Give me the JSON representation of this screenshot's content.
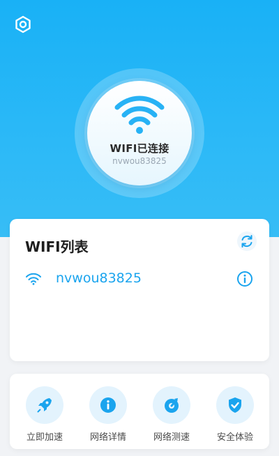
{
  "theme": {
    "accent": "#1aa4ee",
    "hero_gradient_top": "#19b1f6",
    "hero_gradient_bottom": "#37bdf6",
    "icon_bg": "#e3f3fd"
  },
  "header": {
    "settings_icon": "settings-icon"
  },
  "status": {
    "text": "WIFI已连接",
    "ssid": "nvwou83825",
    "icon": "wifi-icon"
  },
  "wifi_list": {
    "title": "WIFI列表",
    "refresh_icon": "refresh-icon",
    "items": [
      {
        "ssid": "nvwou83825",
        "icon": "wifi-icon",
        "info_icon": "info-icon"
      }
    ]
  },
  "actions": [
    {
      "label": "立即加速",
      "icon": "rocket-icon"
    },
    {
      "label": "网络详情",
      "icon": "info-icon"
    },
    {
      "label": "网络测速",
      "icon": "speedometer-icon"
    },
    {
      "label": "安全体验",
      "icon": "shield-check-icon"
    }
  ]
}
